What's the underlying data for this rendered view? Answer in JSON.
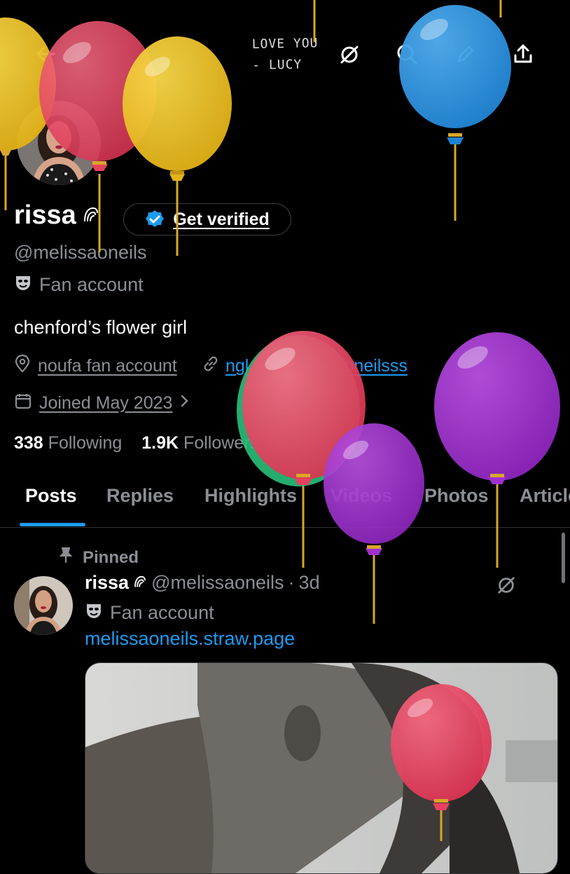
{
  "header": {
    "handwritten_note": [
      "LOVE YOU",
      "- LUCY"
    ]
  },
  "profile": {
    "name": "rissa",
    "verify_label": "Get verified",
    "handle": "@melissaoneils",
    "label": "Fan account",
    "bio": "chenford’s flower girl",
    "location": "noufa fan account",
    "website": "ngl.link/melissaoneilsss",
    "joined": "Joined May 2023",
    "following_count": "338",
    "following_label": "Following",
    "followers_count": "1.9K",
    "followers_label": "Followers"
  },
  "tabs": [
    "Posts",
    "Replies",
    "Highlights",
    "Videos",
    "Photos",
    "Articles"
  ],
  "post": {
    "pinned_label": "Pinned",
    "author": "rissa",
    "handle": "@melissaoneils",
    "separator": "·",
    "time": "3d",
    "label": "Fan account",
    "link": "melissaoneils.straw.page"
  },
  "colors": {
    "accent": "#1d9bf0",
    "balloon_red": "#e8405e",
    "balloon_yellow": "#f2c21b",
    "balloon_blue": "#2f9be8",
    "balloon_purple": "#a12fd0"
  }
}
